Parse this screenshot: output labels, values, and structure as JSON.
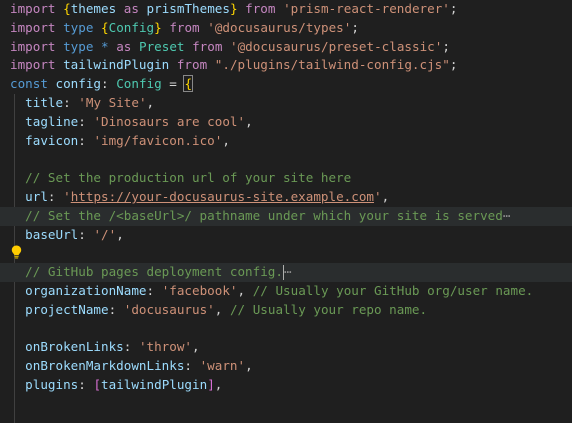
{
  "code": {
    "l1": {
      "kw1": "import",
      "b1": "{",
      "id1": "themes",
      "as": "as",
      "id2": "prismThemes",
      "b2": "}",
      "from": "from",
      "str": "'prism-react-renderer'",
      "end": ";"
    },
    "l2": {
      "kw1": "import",
      "type": "type",
      "b1": "{",
      "ty": "Config",
      "b2": "}",
      "from": "from",
      "str": "'@docusaurus/types'",
      "end": ";"
    },
    "l3": {
      "kw1": "import",
      "type": "type",
      "star": "*",
      "as": "as",
      "ty": "Preset",
      "from": "from",
      "str": "'@docusaurus/preset-classic'",
      "end": ";"
    },
    "l4": {
      "kw1": "import",
      "id": "tailwindPlugin",
      "from": "from",
      "str": "\"./plugins/tailwind-config.cjs\"",
      "end": ";"
    },
    "l5": {
      "const": "const",
      "id": "config",
      "colon": ":",
      "ty": "Config",
      "eq": "=",
      "brace": "{"
    },
    "l6": {
      "key": "title",
      "colon": ":",
      "str": "'My Site'",
      "end": ","
    },
    "l7": {
      "key": "tagline",
      "colon": ":",
      "str": "'Dinosaurs are cool'",
      "end": ","
    },
    "l8": {
      "key": "favicon",
      "colon": ":",
      "str": "'img/favicon.ico'",
      "end": ","
    },
    "l10": {
      "comment": "// Set the production url of your site here"
    },
    "l11": {
      "key": "url",
      "colon": ":",
      "q1": "'",
      "url": "https://your-docusaurus-site.example.com",
      "q2": "'",
      "end": ","
    },
    "l12": {
      "comment": "// Set the /<baseUrl>/ pathname under which your site is served",
      "fold": "⋯"
    },
    "l13": {
      "key": "baseUrl",
      "colon": ":",
      "str": "'/'",
      "end": ","
    },
    "l15": {
      "comment": "// GitHub pages deployment config.",
      "fold": "⋯"
    },
    "l16": {
      "key": "organizationName",
      "colon": ":",
      "str": "'facebook'",
      "end": ",",
      "comment": "// Usually your GitHub org/user name."
    },
    "l17": {
      "key": "projectName",
      "colon": ":",
      "str": "'docusaurus'",
      "end": ",",
      "comment": "// Usually your repo name."
    },
    "l19": {
      "key": "onBrokenLinks",
      "colon": ":",
      "str": "'throw'",
      "end": ","
    },
    "l20": {
      "key": "onBrokenMarkdownLinks",
      "colon": ":",
      "str": "'warn'",
      "end": ","
    },
    "l21": {
      "key": "plugins",
      "colon": ":",
      "lb": "[",
      "id": "tailwindPlugin",
      "rb": "]",
      "end": ","
    }
  },
  "icons": {
    "lightbulb": "lightbulb-icon"
  },
  "colors": {
    "background": "#1f1f1f",
    "keyword": "#c586c0",
    "storage": "#569cd6",
    "string": "#ce9178",
    "comment": "#6a9955",
    "type": "#4ec9b0",
    "identifier": "#9cdcfe",
    "brace": "#ffd700"
  }
}
